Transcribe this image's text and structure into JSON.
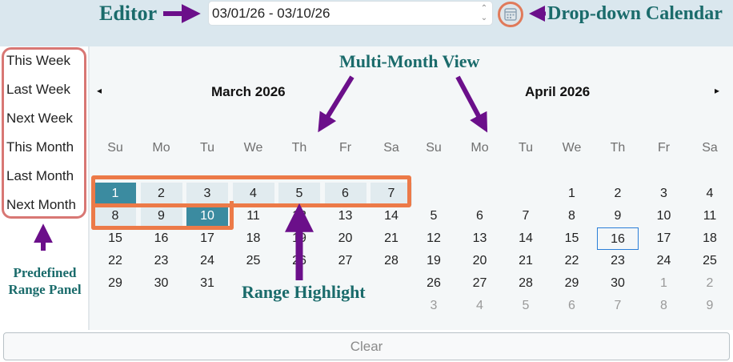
{
  "annotations": {
    "editor": "Editor",
    "dropdown_calendar": "Drop-down Calendar",
    "multi_month_view": "Multi-Month View",
    "range_highlight": "Range Highlight",
    "predefined_range_panel": "Predefined Range Panel"
  },
  "editor": {
    "value": "03/01/26 - 03/10/26",
    "spin_up": "⌃",
    "spin_down": "⌄"
  },
  "predefined_ranges": [
    "This Week",
    "Last Week",
    "Next Week",
    "This Month",
    "Last Month",
    "Next Month"
  ],
  "nav": {
    "prev": "◂",
    "next": "▸"
  },
  "months": [
    {
      "title": "March  2026",
      "weekdays": [
        "Su",
        "Mo",
        "Tu",
        "We",
        "Th",
        "Fr",
        "Sa"
      ],
      "weeks": [
        [
          "1",
          "2",
          "3",
          "4",
          "5",
          "6",
          "7"
        ],
        [
          "8",
          "9",
          "10",
          "11",
          "12",
          "13",
          "14"
        ],
        [
          "15",
          "16",
          "17",
          "18",
          "19",
          "20",
          "21"
        ],
        [
          "22",
          "23",
          "24",
          "25",
          "26",
          "27",
          "28"
        ],
        [
          "29",
          "30",
          "31",
          "",
          "",
          "",
          ""
        ]
      ]
    },
    {
      "title": "April  2026",
      "weekdays": [
        "Su",
        "Mo",
        "Tu",
        "We",
        "Th",
        "Fr",
        "Sa"
      ],
      "weeks": [
        [
          "",
          "",
          "",
          "1",
          "2",
          "3",
          "4"
        ],
        [
          "5",
          "6",
          "7",
          "8",
          "9",
          "10",
          "11"
        ],
        [
          "12",
          "13",
          "14",
          "15",
          "16",
          "17",
          "18"
        ],
        [
          "19",
          "20",
          "21",
          "22",
          "23",
          "24",
          "25"
        ],
        [
          "26",
          "27",
          "28",
          "29",
          "30",
          "1",
          "2"
        ],
        [
          "3",
          "4",
          "5",
          "6",
          "7",
          "8",
          "9"
        ]
      ]
    }
  ],
  "selection": {
    "start": "1",
    "end": "10",
    "month": 0
  },
  "today": {
    "month": 1,
    "day": "16"
  },
  "footer": {
    "clear_label": "Clear"
  },
  "colors": {
    "endpoint": "#3b8ba0",
    "range_fill": "#e1ebef",
    "highlight_outline": "#ec7a48",
    "annotation_arrow": "#6b0f8a",
    "annotation_text": "#1a6b6b",
    "today_border": "#2b7fd8"
  },
  "icons": [
    "calendar-icon",
    "chevron-left-icon",
    "chevron-right-icon",
    "spin-up-icon",
    "spin-down-icon"
  ]
}
